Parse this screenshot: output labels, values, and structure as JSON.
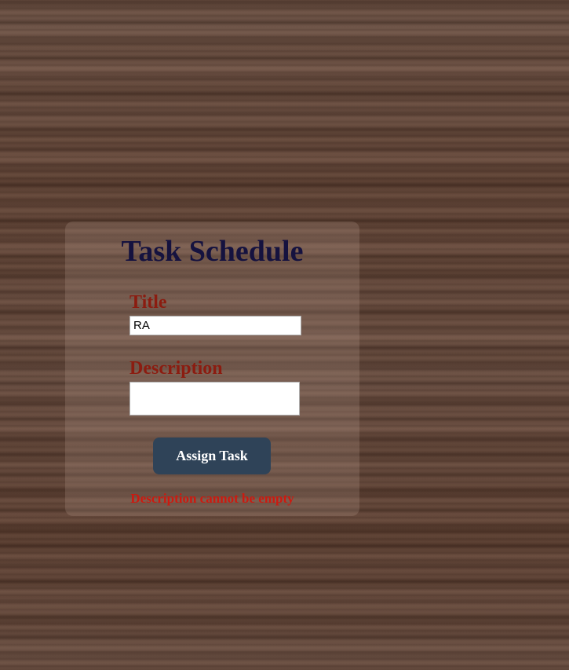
{
  "form": {
    "heading": "Task Schedule",
    "title_label": "Title",
    "title_value": "RA",
    "description_label": "Description",
    "description_value": "",
    "submit_label": "Assign Task",
    "error_message": "Description cannot be empty"
  },
  "colors": {
    "heading": "#15123f",
    "label": "#8b1c10",
    "button_bg": "#2f4358",
    "error": "#cc1a10"
  }
}
